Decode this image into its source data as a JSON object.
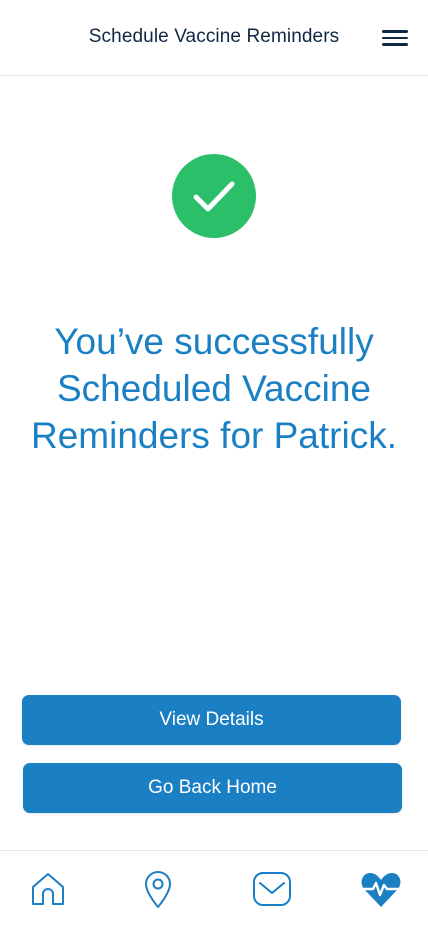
{
  "header": {
    "title": "Schedule Vaccine Reminders",
    "menu_icon": "hamburger-menu-icon"
  },
  "status": {
    "icon": "checkmark-circle-icon",
    "color": "#2bbf6a"
  },
  "message": {
    "text": "You’ve successfully Scheduled Vaccine Reminders for Patrick."
  },
  "actions": {
    "view_details_label": "View Details",
    "go_back_home_label": "Go Back Home"
  },
  "tabbar": {
    "items": [
      {
        "icon": "home-icon",
        "active": false
      },
      {
        "icon": "location-pin-icon",
        "active": false
      },
      {
        "icon": "mail-icon",
        "active": false
      },
      {
        "icon": "heart-pulse-icon",
        "active": true
      }
    ]
  },
  "colors": {
    "accent": "#1b7fc4",
    "title_text": "#0f2742",
    "success": "#2bbf6a"
  }
}
